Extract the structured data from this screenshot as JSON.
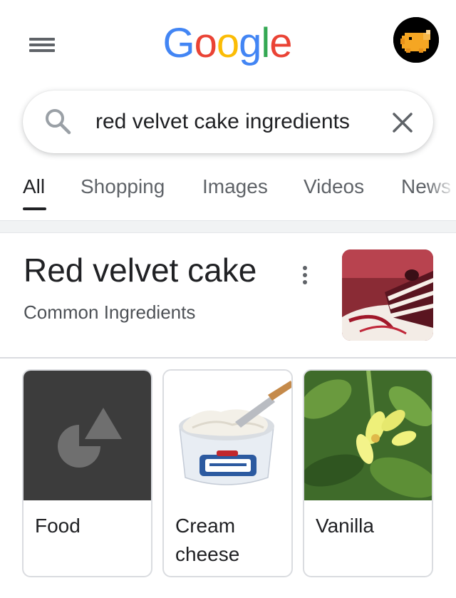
{
  "header": {
    "logo_text": "Google",
    "logo_colors": [
      "#4285F4",
      "#EA4335",
      "#FBBC05",
      "#4285F4",
      "#34A853",
      "#EA4335"
    ],
    "menu_icon": "hamburger-menu-icon",
    "avatar_icon": "pig-avatar-icon"
  },
  "search": {
    "value": "red velvet cake ingredients",
    "search_icon": "search-icon",
    "clear_icon": "close-icon"
  },
  "tabs": [
    {
      "label": "All",
      "active": true
    },
    {
      "label": "Shopping",
      "active": false
    },
    {
      "label": "Images",
      "active": false
    },
    {
      "label": "Videos",
      "active": false
    },
    {
      "label": "News",
      "active": false
    }
  ],
  "knowledge_panel": {
    "title": "Red velvet cake",
    "subtitle": "Common Ingredients",
    "more_icon": "more-vertical-icon",
    "thumbnail": "red-velvet-cake-slice-image"
  },
  "ingredients": [
    {
      "label": "Food",
      "image": "food-placeholder-shapes-icon"
    },
    {
      "label": "Cream cheese",
      "image": "philadelphia-cream-cheese-tub-image"
    },
    {
      "label": "Vanilla",
      "image": "vanilla-flower-plant-image"
    }
  ],
  "colors": {
    "text_primary": "#202124",
    "text_secondary": "#5f6368",
    "border": "#dadce0",
    "placeholder_bg": "#3c3c3c"
  }
}
